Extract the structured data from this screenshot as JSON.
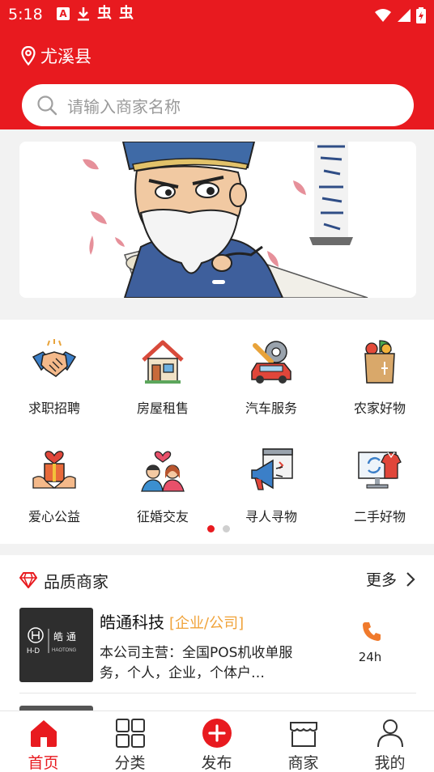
{
  "status_bar": {
    "time": "5:18",
    "glyph": "虫"
  },
  "header": {
    "location": "尤溪县"
  },
  "search": {
    "placeholder": "请输入商家名称"
  },
  "categories": [
    {
      "label": "求职招聘",
      "icon": "handshake-icon"
    },
    {
      "label": "房屋租售",
      "icon": "house-icon"
    },
    {
      "label": "汽车服务",
      "icon": "car-service-icon"
    },
    {
      "label": "农家好物",
      "icon": "produce-bag-icon"
    },
    {
      "label": "爱心公益",
      "icon": "charity-gift-icon"
    },
    {
      "label": "征婚交友",
      "icon": "couple-icon"
    },
    {
      "label": "寻人寻物",
      "icon": "megaphone-icon"
    },
    {
      "label": "二手好物",
      "icon": "secondhand-monitor-icon"
    }
  ],
  "section": {
    "title": "品质商家",
    "more": "更多"
  },
  "merchants": [
    {
      "name": "皓通科技",
      "tag": "[企业/公司]",
      "description": "本公司主营：全国POS机收单服务，个人，企业，个体户…",
      "hours": "24h",
      "logo_text": "H-D 皓通 HAOTONG"
    }
  ],
  "tabs": [
    {
      "label": "首页",
      "icon": "home-icon",
      "active": true
    },
    {
      "label": "分类",
      "icon": "grid-icon",
      "active": false
    },
    {
      "label": "发布",
      "icon": "plus-circle-icon",
      "active": false
    },
    {
      "label": "商家",
      "icon": "shop-icon",
      "active": false
    },
    {
      "label": "我的",
      "icon": "user-icon",
      "active": false
    }
  ],
  "colors": {
    "brand_red": "#e81a1f",
    "tag_orange": "#f0a33a",
    "phone_orange": "#f07a2c"
  }
}
